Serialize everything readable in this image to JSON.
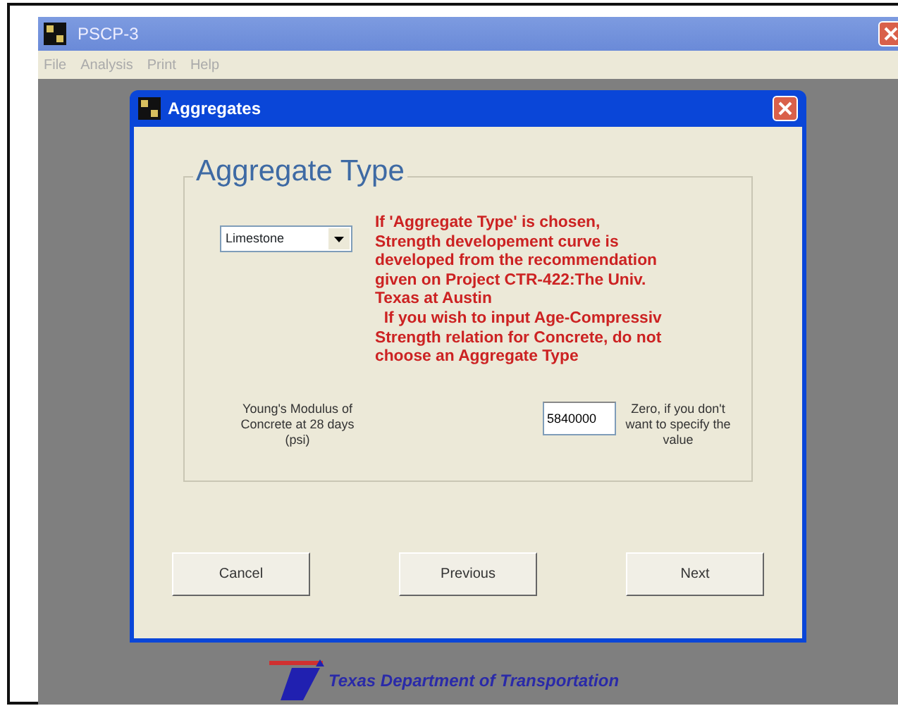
{
  "window": {
    "title": "PSCP-3"
  },
  "menu": [
    "File",
    "Analysis",
    "Print",
    "Help"
  ],
  "dialog": {
    "title": "Aggregates",
    "group_title": "Aggregate Type",
    "aggregate_select": {
      "value": "Limestone"
    },
    "note_lines": [
      "If 'Aggregate Type' is chosen,",
      "Strength developement curve is",
      "developed from the recommendation",
      "given on Project CTR-422:The Univ.",
      "Texas at Austin",
      "  If you wish to input Age-Compressiv",
      "Strength relation for Concrete, do not",
      "choose an Aggregate Type"
    ],
    "modulus_label": "Young's Modulus of Concrete at 28 days (psi)",
    "modulus_field": {
      "value": "5840000"
    },
    "modulus_hint": "Zero, if you don't want to specify the value",
    "buttons": [
      "Cancel",
      "Previous",
      "Next"
    ]
  },
  "footer_logo": {
    "text": "Texas Department of Transportation"
  }
}
